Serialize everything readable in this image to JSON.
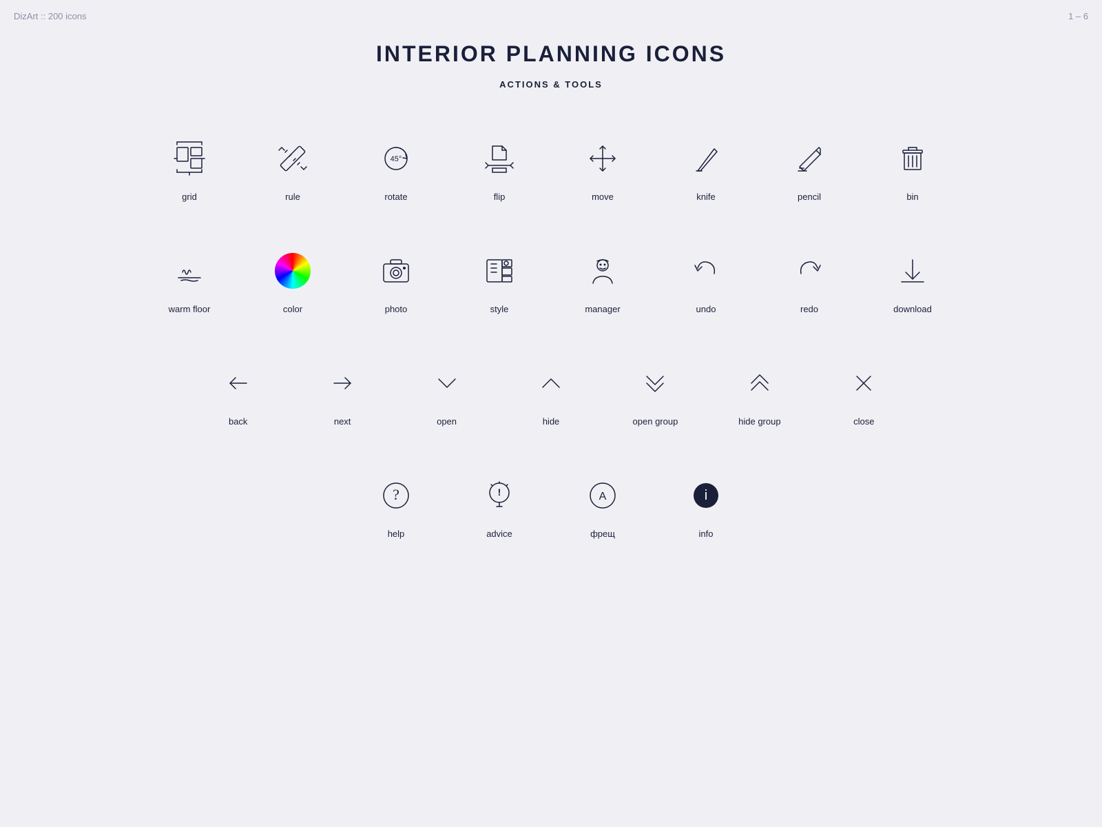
{
  "header": {
    "brand": "DizArt :: 200 icons",
    "pagination": "1 – 6"
  },
  "title": "INTERIOR PLANNING ICONS",
  "subtitle": "ACTIONS & TOOLS",
  "row1": [
    {
      "label": "grid"
    },
    {
      "label": "rule"
    },
    {
      "label": "rotate"
    },
    {
      "label": "flip"
    },
    {
      "label": "move"
    },
    {
      "label": "knife"
    },
    {
      "label": "pencil"
    },
    {
      "label": "bin"
    }
  ],
  "row2": [
    {
      "label": "warm floor"
    },
    {
      "label": "color"
    },
    {
      "label": "photo"
    },
    {
      "label": "style"
    },
    {
      "label": "manager"
    },
    {
      "label": "undo"
    },
    {
      "label": "redo"
    },
    {
      "label": "download"
    }
  ],
  "row3": [
    {
      "label": "back"
    },
    {
      "label": "next"
    },
    {
      "label": "open"
    },
    {
      "label": "hide"
    },
    {
      "label": "open group"
    },
    {
      "label": "hide group"
    },
    {
      "label": "close"
    }
  ],
  "row4": [
    {
      "label": ""
    },
    {
      "label": ""
    },
    {
      "label": "help"
    },
    {
      "label": "advice"
    },
    {
      "label": "фрещ"
    },
    {
      "label": "info"
    },
    {
      "label": ""
    },
    {
      "label": ""
    }
  ]
}
